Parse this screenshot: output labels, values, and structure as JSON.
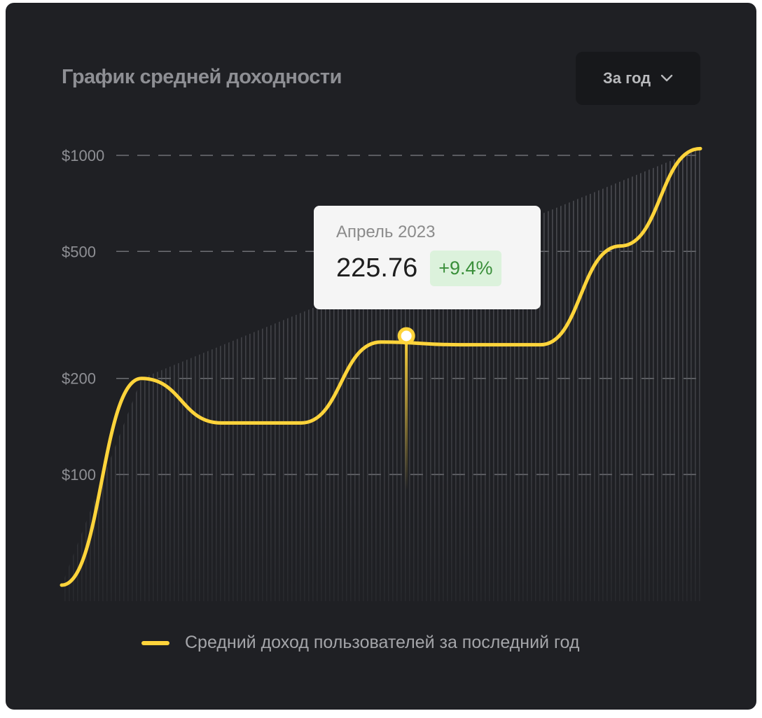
{
  "header": {
    "title": "График средней доходности",
    "period_select": {
      "selected": "За год",
      "icon": "chevron-down-icon"
    }
  },
  "tooltip": {
    "date": "Апрель 2023",
    "value": "225.76",
    "change": "+9.4%"
  },
  "legend": {
    "label": "Средний доход пользователей за последний год"
  },
  "colors": {
    "background": "#1f2024",
    "line": "#ffd43b",
    "grid": "#6e6f74",
    "tick": "#8e8f94",
    "badge_bg": "#dcf2dc",
    "badge_text": "#3a8f3a"
  },
  "chart_data": {
    "type": "line",
    "title": "График средней доходности",
    "y_scale": "log",
    "ylim": [
      30,
      1050
    ],
    "y_ticks": [
      {
        "value": 100,
        "label": "$100"
      },
      {
        "value": 200,
        "label": "$200"
      },
      {
        "value": 500,
        "label": "$500"
      },
      {
        "value": 1000,
        "label": "$1000"
      }
    ],
    "grid": true,
    "legend_position": "bottom",
    "series": [
      {
        "name": "Средний доход пользователей за последний год",
        "x": [
          0,
          1,
          2,
          3,
          4,
          5,
          6,
          7,
          8
        ],
        "y": [
          45,
          200,
          145,
          145,
          260,
          255,
          255,
          520,
          1050
        ]
      }
    ],
    "highlight": {
      "x": 4.3,
      "y": 225.76,
      "label": "Апрель 2023",
      "change": "+9.4%"
    }
  }
}
